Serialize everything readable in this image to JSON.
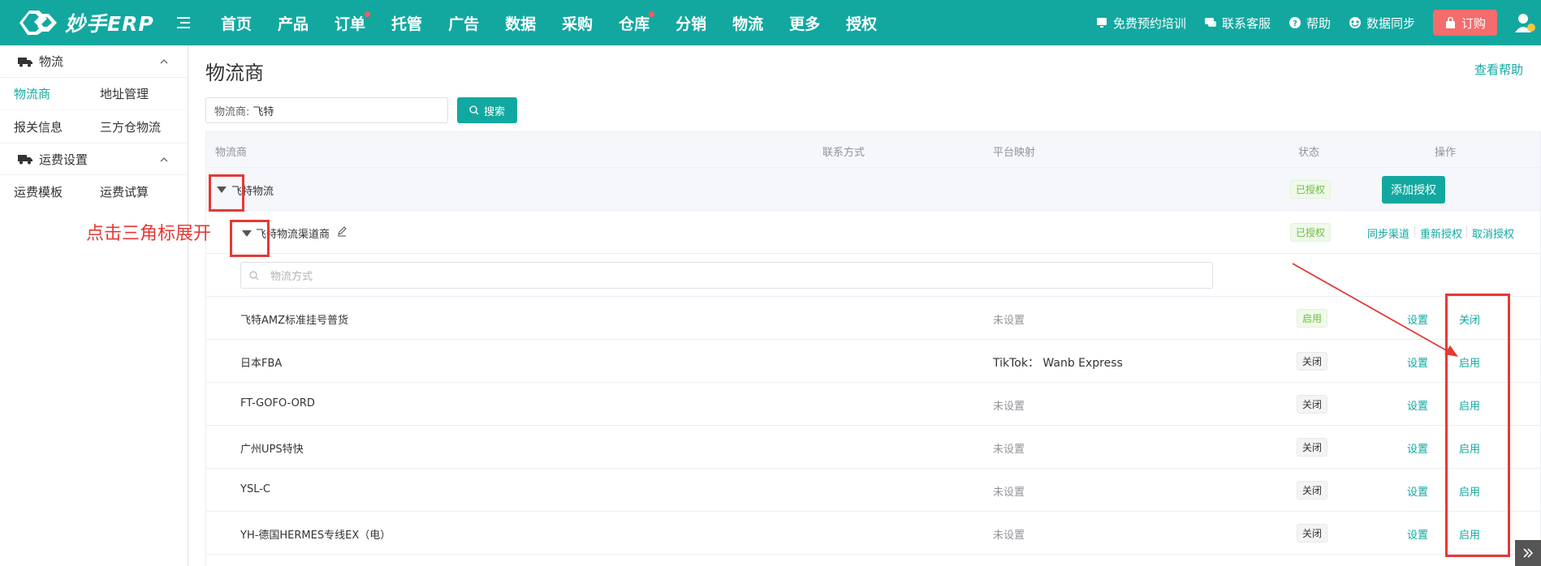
{
  "app": {
    "logo_text": "妙手ERP"
  },
  "nav": [
    {
      "label": "首页",
      "dot": false
    },
    {
      "label": "产品",
      "dot": false
    },
    {
      "label": "订单",
      "dot": true
    },
    {
      "label": "托管",
      "dot": false
    },
    {
      "label": "广告",
      "dot": false
    },
    {
      "label": "数据",
      "dot": false
    },
    {
      "label": "采购",
      "dot": false
    },
    {
      "label": "仓库",
      "dot": true
    },
    {
      "label": "分销",
      "dot": false
    },
    {
      "label": "物流",
      "dot": false
    },
    {
      "label": "更多",
      "dot": false
    },
    {
      "label": "授权",
      "dot": false
    }
  ],
  "top_right": {
    "training": "免费预约培训",
    "service": "联系客服",
    "help": "帮助",
    "sync": "数据同步",
    "order": "订购"
  },
  "sidebar": {
    "group1": "物流",
    "group1_items": [
      "物流商",
      "地址管理",
      "报关信息",
      "三方仓物流"
    ],
    "group2": "运费设置",
    "group2_items": [
      "运费模板",
      "运费试算"
    ]
  },
  "page": {
    "title": "物流商",
    "help": "查看帮助",
    "search_label": "物流商:",
    "search_value": "飞特",
    "search_button": "搜索"
  },
  "table": {
    "headers": {
      "provider": "物流商",
      "contact": "联系方式",
      "mapping": "平台映射",
      "status": "状态",
      "actions": "操作"
    },
    "provider_row": {
      "name": "飞特物流",
      "status": "已授权",
      "action": "添加授权"
    },
    "channel_row": {
      "name": "飞特物流渠道商",
      "status": "已授权",
      "actions": [
        "同步渠道",
        "重新授权",
        "取消授权"
      ]
    },
    "filter_placeholder": "物流方式",
    "methods": [
      {
        "name": "飞特AMZ标准挂号普货",
        "mapping": "未设置",
        "mapped": false,
        "status": "启用",
        "enabled": true,
        "set": "设置",
        "toggle": "关闭"
      },
      {
        "name": "日本FBA",
        "mapping": "TikTok： Wanb Express",
        "mapped": true,
        "status": "关闭",
        "enabled": false,
        "set": "设置",
        "toggle": "启用"
      },
      {
        "name": "FT-GOFO-ORD",
        "mapping": "未设置",
        "mapped": false,
        "status": "关闭",
        "enabled": false,
        "set": "设置",
        "toggle": "启用"
      },
      {
        "name": "广州UPS特快",
        "mapping": "未设置",
        "mapped": false,
        "status": "关闭",
        "enabled": false,
        "set": "设置",
        "toggle": "启用"
      },
      {
        "name": "YSL-C",
        "mapping": "未设置",
        "mapped": false,
        "status": "关闭",
        "enabled": false,
        "set": "设置",
        "toggle": "启用"
      },
      {
        "name": "YH-德国HERMES专线EX（电）",
        "mapping": "未设置",
        "mapped": false,
        "status": "关闭",
        "enabled": false,
        "set": "设置",
        "toggle": "启用"
      }
    ]
  },
  "annotation": {
    "text": "点击三角标展开",
    "color": "#e53935"
  },
  "colors": {
    "brand": "#12a8a0",
    "danger": "#f56c6c"
  }
}
